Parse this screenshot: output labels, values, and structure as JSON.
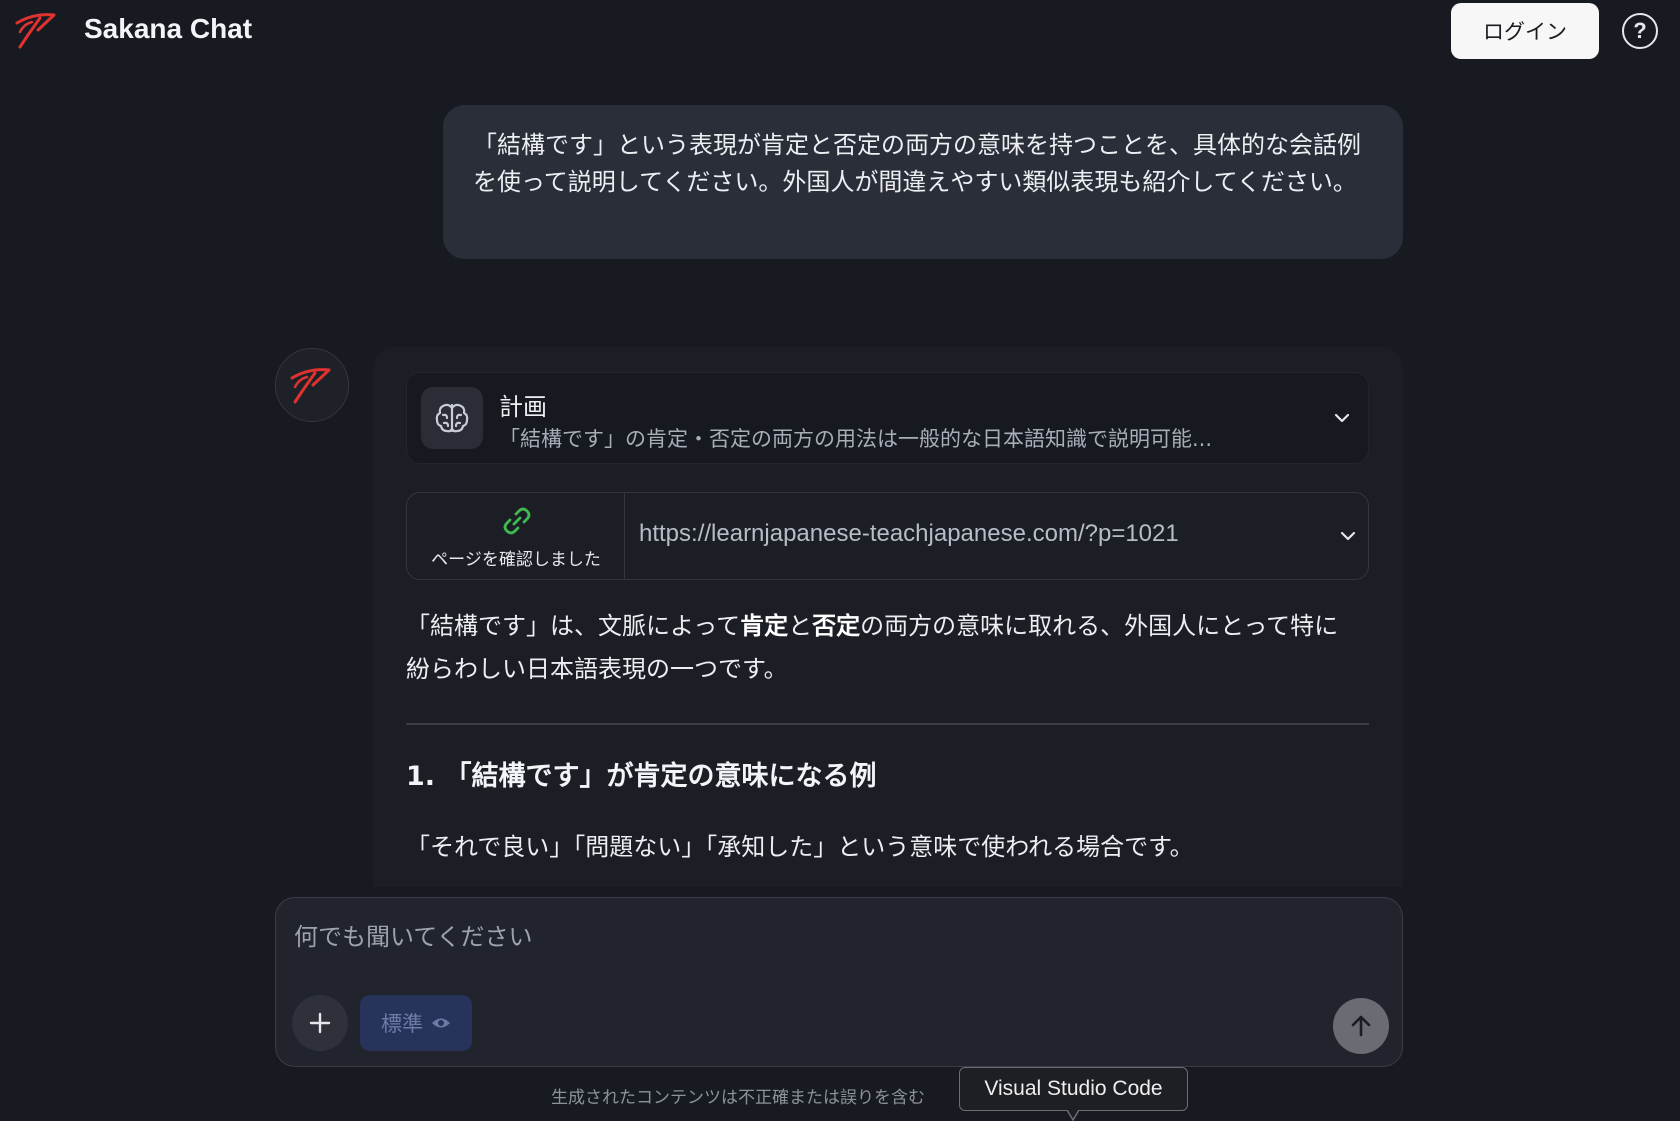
{
  "header": {
    "title": "Sakana Chat",
    "login_label": "ログイン",
    "help_label": "?",
    "logo_icon": "sakana-fish-logo"
  },
  "conversation": {
    "user_message": "「結構です」という表現が肯定と否定の両方の意味を持つことを、具体的な会話例を使って説明してください。外国人が間違えやすい類似表現も紹介してください。",
    "assistant": {
      "plan": {
        "title": "計画",
        "summary": "「結構です」の肯定・否定の両方の用法は一般的な日本語知識で説明可能...",
        "icon": "brain-icon"
      },
      "source": {
        "label": "ページを確認しました",
        "url": "https://learnjapanese-teachjapanese.com/?p=1021",
        "icon": "link-icon"
      },
      "intro": {
        "part1": "「結構です」は、文脈によって",
        "bold1": "肯定",
        "part2": "と",
        "bold2": "否定",
        "part3": "の両方の意味に取れる、外国人にとって特に紛らわしい日本語表現の一つです。"
      },
      "section_heading": "1. 「結構です」が肯定の意味になる例",
      "section_text": "「それで良い」「問題ない」「承知した」という意味で使われる場合です。"
    }
  },
  "composer": {
    "placeholder": "何でも聞いてください",
    "mode_label": "標準",
    "plus_icon": "plus-icon",
    "send_icon": "arrow-up-icon"
  },
  "footer": {
    "disclaimer": "生成されたコンテンツは不正確または誤りを含む"
  },
  "tooltip": {
    "text": "Visual Studio Code"
  },
  "colors": {
    "background": "#181a21",
    "accent_red": "#e0322f",
    "link_green": "#3fb950",
    "mode_button_bg": "#27335a"
  }
}
